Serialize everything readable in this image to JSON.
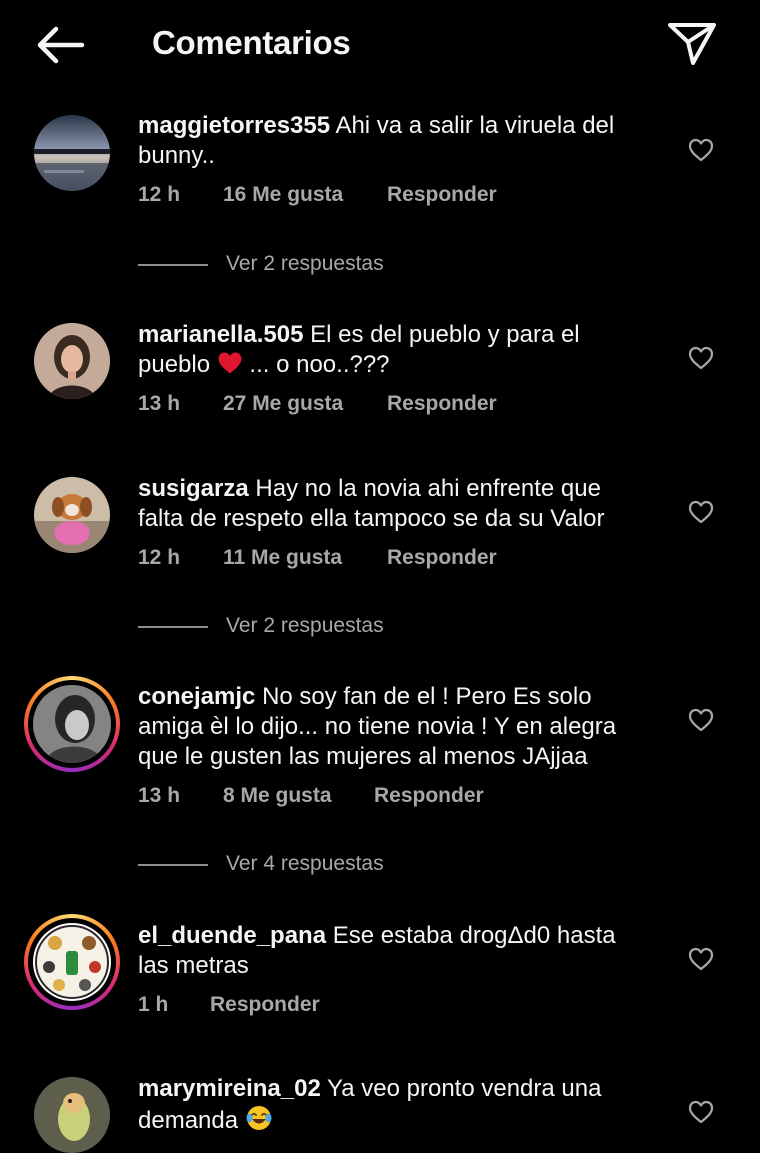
{
  "header": {
    "title": "Comentarios",
    "back_icon": "back-arrow-icon",
    "share_icon": "paper-plane-icon"
  },
  "colors": {
    "background": "#000000",
    "text_primary": "#f5f5f5",
    "text_secondary": "#a8a8a8",
    "story_ring": "#d62976"
  },
  "comments": [
    {
      "username": "maggietorres355",
      "text": "Ahi va a salir la viruela del bunny..",
      "time": "12 h",
      "likes": "16 Me gusta",
      "reply_label": "Responder",
      "view_replies": "Ver 2 respuestas"
    },
    {
      "username": "marianella.505",
      "text_before_emoji": "El es del pueblo y para el pueblo",
      "emoji": "red-heart",
      "text_after_emoji": "... o noo..???",
      "time": "13 h",
      "likes": "27 Me gusta",
      "reply_label": "Responder"
    },
    {
      "username": "susigarza",
      "text": "Hay no la novia ahi enfrente que falta de respeto ella tampoco se da su Valor",
      "time": "12 h",
      "likes": "11 Me gusta",
      "reply_label": "Responder",
      "view_replies": "Ver 2 respuestas"
    },
    {
      "username": "conejamjc",
      "text": "No soy fan de el ! Pero Es solo amiga èl lo dijo... no tiene novia ! Y en alegra que le gusten las mujeres al menos JAjjaa",
      "time": "13 h",
      "likes": "8 Me gusta",
      "reply_label": "Responder",
      "view_replies": "Ver 4 respuestas"
    },
    {
      "username": "el_duende_pana",
      "text": "Ese estaba drogΔd0 hasta las metras",
      "time": "1 h",
      "reply_label": "Responder"
    },
    {
      "username": "marymireina_02",
      "text": "Ya veo pronto vendra una demanda",
      "emoji": "tears-of-joy"
    }
  ]
}
